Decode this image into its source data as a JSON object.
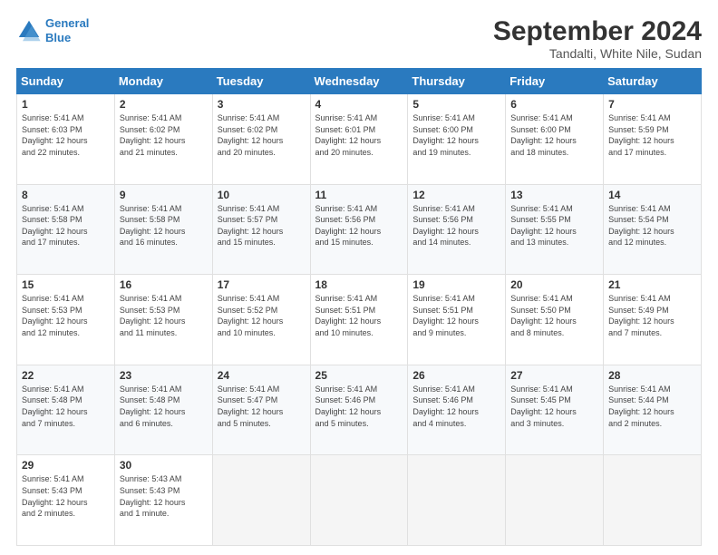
{
  "logo": {
    "line1": "General",
    "line2": "Blue"
  },
  "title": "September 2024",
  "subtitle": "Tandalti, White Nile, Sudan",
  "header_days": [
    "Sunday",
    "Monday",
    "Tuesday",
    "Wednesday",
    "Thursday",
    "Friday",
    "Saturday"
  ],
  "weeks": [
    [
      {
        "day": "1",
        "info": "Sunrise: 5:41 AM\nSunset: 6:03 PM\nDaylight: 12 hours\nand 22 minutes."
      },
      {
        "day": "2",
        "info": "Sunrise: 5:41 AM\nSunset: 6:02 PM\nDaylight: 12 hours\nand 21 minutes."
      },
      {
        "day": "3",
        "info": "Sunrise: 5:41 AM\nSunset: 6:02 PM\nDaylight: 12 hours\nand 20 minutes."
      },
      {
        "day": "4",
        "info": "Sunrise: 5:41 AM\nSunset: 6:01 PM\nDaylight: 12 hours\nand 20 minutes."
      },
      {
        "day": "5",
        "info": "Sunrise: 5:41 AM\nSunset: 6:00 PM\nDaylight: 12 hours\nand 19 minutes."
      },
      {
        "day": "6",
        "info": "Sunrise: 5:41 AM\nSunset: 6:00 PM\nDaylight: 12 hours\nand 18 minutes."
      },
      {
        "day": "7",
        "info": "Sunrise: 5:41 AM\nSunset: 5:59 PM\nDaylight: 12 hours\nand 17 minutes."
      }
    ],
    [
      {
        "day": "8",
        "info": "Sunrise: 5:41 AM\nSunset: 5:58 PM\nDaylight: 12 hours\nand 17 minutes."
      },
      {
        "day": "9",
        "info": "Sunrise: 5:41 AM\nSunset: 5:58 PM\nDaylight: 12 hours\nand 16 minutes."
      },
      {
        "day": "10",
        "info": "Sunrise: 5:41 AM\nSunset: 5:57 PM\nDaylight: 12 hours\nand 15 minutes."
      },
      {
        "day": "11",
        "info": "Sunrise: 5:41 AM\nSunset: 5:56 PM\nDaylight: 12 hours\nand 15 minutes."
      },
      {
        "day": "12",
        "info": "Sunrise: 5:41 AM\nSunset: 5:56 PM\nDaylight: 12 hours\nand 14 minutes."
      },
      {
        "day": "13",
        "info": "Sunrise: 5:41 AM\nSunset: 5:55 PM\nDaylight: 12 hours\nand 13 minutes."
      },
      {
        "day": "14",
        "info": "Sunrise: 5:41 AM\nSunset: 5:54 PM\nDaylight: 12 hours\nand 12 minutes."
      }
    ],
    [
      {
        "day": "15",
        "info": "Sunrise: 5:41 AM\nSunset: 5:53 PM\nDaylight: 12 hours\nand 12 minutes."
      },
      {
        "day": "16",
        "info": "Sunrise: 5:41 AM\nSunset: 5:53 PM\nDaylight: 12 hours\nand 11 minutes."
      },
      {
        "day": "17",
        "info": "Sunrise: 5:41 AM\nSunset: 5:52 PM\nDaylight: 12 hours\nand 10 minutes."
      },
      {
        "day": "18",
        "info": "Sunrise: 5:41 AM\nSunset: 5:51 PM\nDaylight: 12 hours\nand 10 minutes."
      },
      {
        "day": "19",
        "info": "Sunrise: 5:41 AM\nSunset: 5:51 PM\nDaylight: 12 hours\nand 9 minutes."
      },
      {
        "day": "20",
        "info": "Sunrise: 5:41 AM\nSunset: 5:50 PM\nDaylight: 12 hours\nand 8 minutes."
      },
      {
        "day": "21",
        "info": "Sunrise: 5:41 AM\nSunset: 5:49 PM\nDaylight: 12 hours\nand 7 minutes."
      }
    ],
    [
      {
        "day": "22",
        "info": "Sunrise: 5:41 AM\nSunset: 5:48 PM\nDaylight: 12 hours\nand 7 minutes."
      },
      {
        "day": "23",
        "info": "Sunrise: 5:41 AM\nSunset: 5:48 PM\nDaylight: 12 hours\nand 6 minutes."
      },
      {
        "day": "24",
        "info": "Sunrise: 5:41 AM\nSunset: 5:47 PM\nDaylight: 12 hours\nand 5 minutes."
      },
      {
        "day": "25",
        "info": "Sunrise: 5:41 AM\nSunset: 5:46 PM\nDaylight: 12 hours\nand 5 minutes."
      },
      {
        "day": "26",
        "info": "Sunrise: 5:41 AM\nSunset: 5:46 PM\nDaylight: 12 hours\nand 4 minutes."
      },
      {
        "day": "27",
        "info": "Sunrise: 5:41 AM\nSunset: 5:45 PM\nDaylight: 12 hours\nand 3 minutes."
      },
      {
        "day": "28",
        "info": "Sunrise: 5:41 AM\nSunset: 5:44 PM\nDaylight: 12 hours\nand 2 minutes."
      }
    ],
    [
      {
        "day": "29",
        "info": "Sunrise: 5:41 AM\nSunset: 5:43 PM\nDaylight: 12 hours\nand 2 minutes."
      },
      {
        "day": "30",
        "info": "Sunrise: 5:43 AM\nSunset: 5:43 PM\nDaylight: 12 hours\nand 1 minute."
      },
      {
        "day": "",
        "info": ""
      },
      {
        "day": "",
        "info": ""
      },
      {
        "day": "",
        "info": ""
      },
      {
        "day": "",
        "info": ""
      },
      {
        "day": "",
        "info": ""
      }
    ]
  ]
}
